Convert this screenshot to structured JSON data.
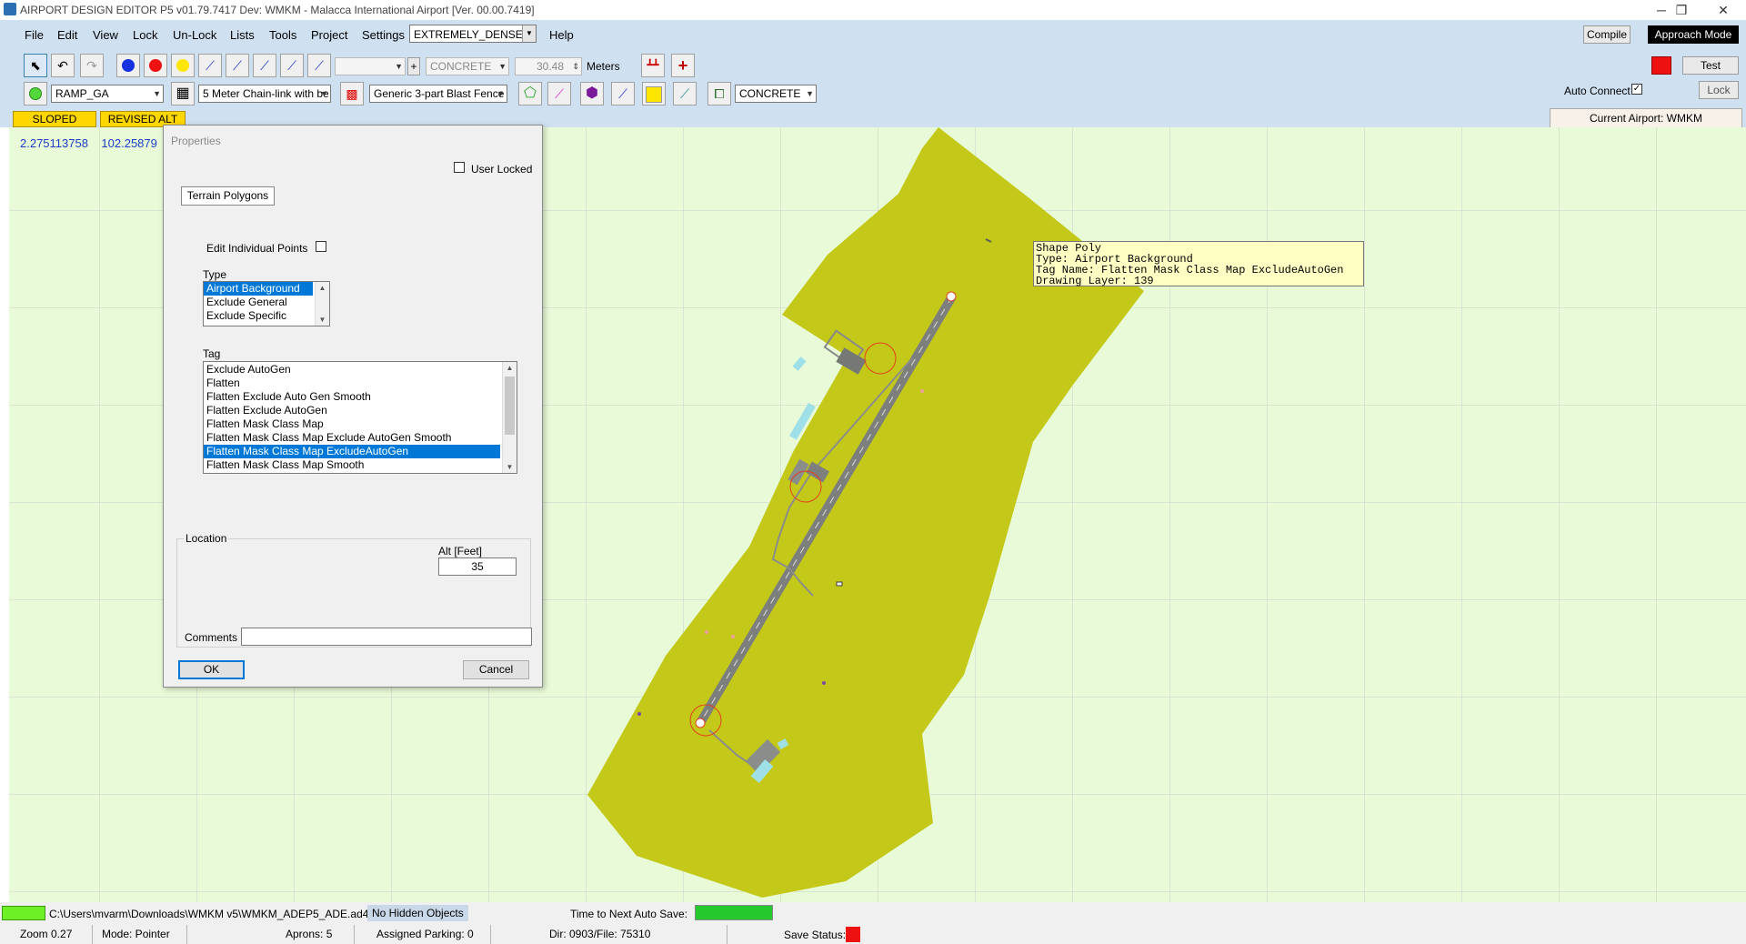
{
  "window": {
    "title": "AIRPORT DESIGN EDITOR P5  v01.79.7417 Dev: WMKM - Malacca International Airport [Ver. 00.00.7419]",
    "minimize": "─",
    "restore": "❐",
    "close": "✕"
  },
  "menu": {
    "items": [
      "File",
      "Edit",
      "View",
      "Lock",
      "Un-Lock",
      "Lists",
      "Tools",
      "Project",
      "Settings"
    ],
    "density_value": "EXTREMELY_DENSE",
    "help": "Help"
  },
  "toolbar": {
    "surface_combo": "CONCRETE",
    "width_value": "30.48",
    "units_label": "Meters",
    "ramp_combo": "RAMP_GA",
    "fence_combo": "5 Meter Chain-link with be",
    "blast_fence_combo": "Generic 3-part Blast Fence",
    "surface_combo2": "CONCRETE",
    "compile_label": "Compile",
    "approach_label": "Approach Mode",
    "test_label": "Test",
    "auto_connect_label": "Auto Connect",
    "lock_label": "Lock",
    "current_airport": "Current Airport: WMKM",
    "sloped_label": "SLOPED",
    "revised_alt_label": "REVISED ALT",
    "accent_red": "#ee1111",
    "accent_yellow": "#ffd700"
  },
  "map": {
    "latitude": "2.275113758",
    "longitude": "102.25879",
    "terrain_color": "#c4c818",
    "grid_color": "#e9fad8"
  },
  "tooltip": {
    "line1": "Shape Poly",
    "line2": "Type: Airport Background",
    "line3": "Tag Name: Flatten Mask Class Map ExcludeAutoGen",
    "line4": "Drawing Layer: 139"
  },
  "dialog": {
    "title": "Properties",
    "user_locked_label": "User Locked",
    "section_button": "Terrain Polygons",
    "edit_points_label": "Edit Individual Points",
    "type_label": "Type",
    "type_options": [
      "Airport Background",
      "Exclude General",
      "Exclude Specific"
    ],
    "tag_label": "Tag",
    "tag_options": [
      "Exclude AutoGen",
      "Flatten",
      "Flatten Exclude Auto Gen Smooth",
      "Flatten Exclude AutoGen",
      "Flatten Mask Class Map",
      "Flatten Mask Class Map Exclude AutoGen Smooth",
      "Flatten Mask Class Map ExcludeAutoGen",
      "Flatten Mask Class Map Smooth"
    ],
    "location_label": "Location",
    "alt_label": "Alt [Feet]",
    "alt_value": "35",
    "comments_label": "Comments",
    "comments_value": "",
    "ok_label": "OK",
    "cancel_label": "Cancel"
  },
  "status": {
    "file_path": "C:\\Users\\mvarm\\Downloads\\WMKM v5\\WMKM_ADEP5_ADE.ad4",
    "hidden_objects": "No Hidden Objects",
    "autosave_label": "Time to Next Auto Save:",
    "zoom": "Zoom 0.27",
    "mode": "Mode: Pointer",
    "aprons": "Aprons: 5",
    "parking": "Assigned Parking: 0",
    "dir_file": "Dir: 0903/File: 75310",
    "save_status_label": "Save Status:"
  }
}
